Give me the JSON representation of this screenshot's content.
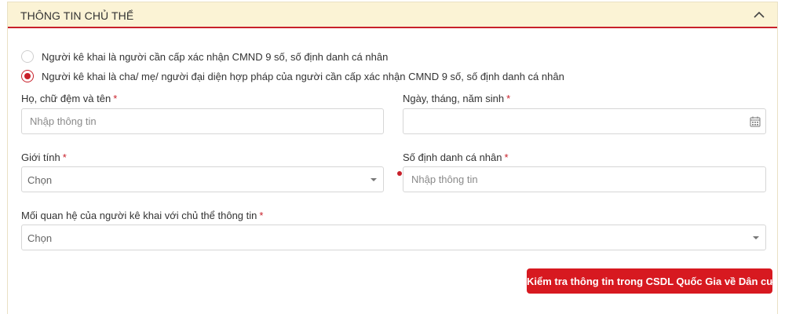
{
  "section": {
    "title": "THÔNG TIN CHỦ THỂ"
  },
  "declarant_options": [
    {
      "label": "Người kê khai là người cần cấp xác nhận CMND 9 số, số định danh cá nhân",
      "selected": false
    },
    {
      "label": "Người kê khai là cha/ mẹ/ người đại diện hợp pháp của người cần cấp xác nhận CMND 9 số, số định danh cá nhân",
      "selected": true
    }
  ],
  "form": {
    "full_name": {
      "label": "Họ, chữ đệm và tên",
      "required_mark": "*",
      "placeholder": "Nhập thông tin",
      "value": ""
    },
    "birth_date": {
      "label": "Ngày, tháng, năm sinh",
      "required_mark": "*",
      "value": ""
    },
    "gender": {
      "label": "Giới tính",
      "required_mark": "*",
      "selected": "Chọn"
    },
    "personal_id": {
      "label": "Số định danh cá nhân",
      "required_mark": "*",
      "placeholder": "Nhập thông tin",
      "value": ""
    },
    "relationship": {
      "label": "Mối quan hệ của người kê khai với chủ thể thông tin",
      "required_mark": "*",
      "selected": "Chọn"
    }
  },
  "actions": {
    "check_label": "Kiểm tra thông tin trong CSDL Quốc Gia về Dân cư"
  },
  "colors": {
    "accent": "#c8202a",
    "button": "#d71920",
    "header_bg": "#fbf3d5"
  },
  "icons": {
    "collapse": "chevron-up-icon",
    "calendar": "calendar-icon",
    "dropdown": "caret-down-icon"
  }
}
